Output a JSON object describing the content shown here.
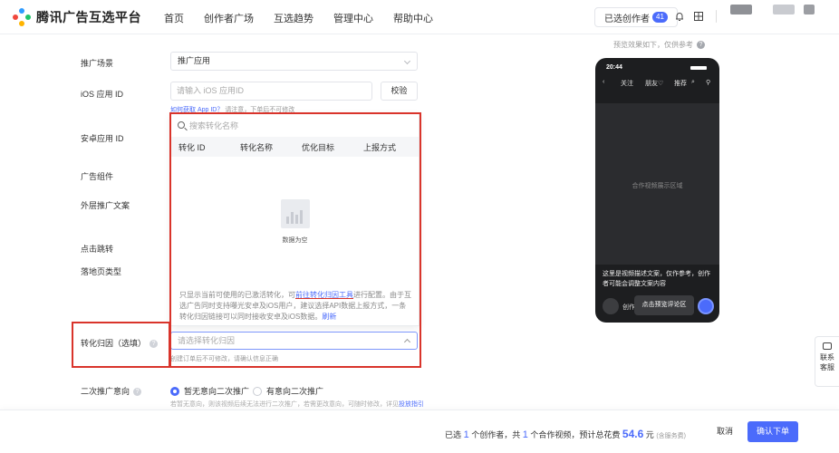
{
  "header": {
    "brand": "腾讯广告互选平台",
    "nav": [
      "首页",
      "创作者广场",
      "互选趋势",
      "管理中心",
      "帮助中心"
    ],
    "selected_creators_label": "已选创作者",
    "selected_creators_count": "41"
  },
  "form": {
    "scene_label": "推广场景",
    "scene_value": "推广应用",
    "ios_label": "iOS 应用 ID",
    "ios_placeholder": "请输入 iOS 应用ID",
    "verify_button": "校验",
    "how_link": "如何获取 App ID？",
    "how_rest": "请注意，下单后不可修改",
    "android_label": "安卓应用 ID",
    "component_label": "广告组件",
    "copy_label": "外层推广文案",
    "jump_label": "点击跳转",
    "landing_label": "落地页类型",
    "attribution_label": "转化归因（选填）",
    "attribution_placeholder": "请选择转化归因",
    "attribution_hint": "创建订单后不可修改，请确认信息正确",
    "secondary_label": "二次推广意向",
    "radio_no": "暂无意向二次推广",
    "radio_yes": "有意向二次推广",
    "radio_hint_text": "若暂无意向，则该视频后续无法进行二次推广，若需更改意向，可随时修改，详见",
    "radio_hint_link": "投放指引"
  },
  "dropdown": {
    "search_placeholder": "搜索转化名称",
    "columns": [
      "转化 ID",
      "转化名称",
      "优化目标",
      "上报方式"
    ],
    "empty_text": "数据为空",
    "note_part1": "只显示当前可使用的已激活转化，可",
    "note_link": "前往转化归因工具",
    "note_part2": "进行配置。由于互选广告同时支持曝光安卓及iOS用户，建议选择API数据上报方式，一条转化归因链接可以同时接收安卓及iOS数据。",
    "note_refresh": "刷新"
  },
  "preview": {
    "caption": "预览效果如下，仅供参考",
    "time": "20:44",
    "tab_follow": "关注",
    "tab_friends": "朋友♡",
    "tab_recommend": "推荐",
    "video_placeholder": "合作视频展示区域",
    "description": "这里是视频描述文案，仅作参考，创作者可能会调整文案内容",
    "author": "创作者",
    "comment_button": "点击预览评论区"
  },
  "side_help": {
    "line1": "联系",
    "line2": "客服"
  },
  "footer": {
    "p1": "已选",
    "creators": "1",
    "p2": "个创作者，共",
    "videos": "1",
    "p3": "个合作视频，预计总花费",
    "cost": "54.6",
    "unit": "元",
    "tax": "(含服务费)",
    "cancel": "取消",
    "confirm": "确认下单"
  },
  "colors": {
    "accent": "#4b6bfb",
    "highlight": "#d9342b"
  }
}
